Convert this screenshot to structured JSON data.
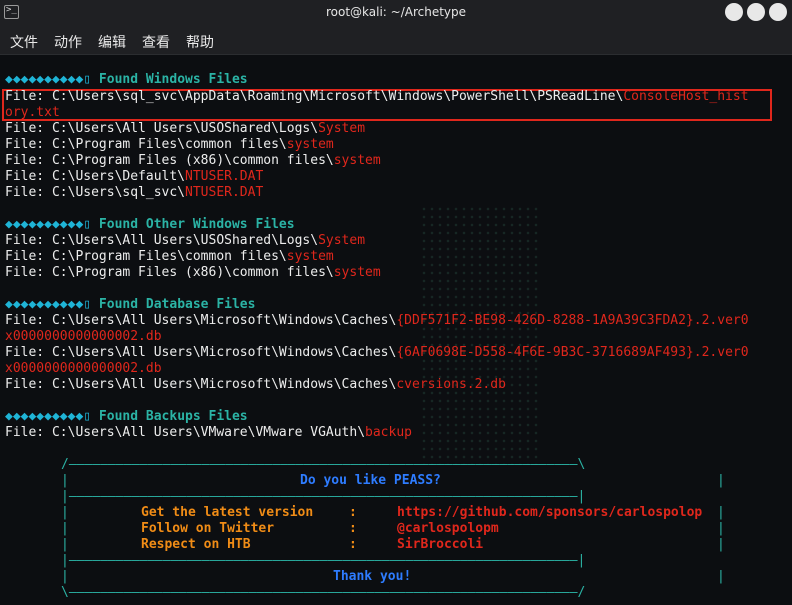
{
  "window": {
    "title": "root@kali: ~/Archetype"
  },
  "menu": [
    "文件",
    "动作",
    "编辑",
    "查看",
    "帮助"
  ],
  "sections": {
    "windows_files": {
      "header": "Found Windows Files",
      "highlight_line": {
        "prefix": "File: C:\\Users\\sql_svc\\AppData\\Roaming\\Microsoft\\Windows\\PowerShell\\PSReadLine\\",
        "name_part1": "ConsoleHost_hist",
        "name_part2": "ory.txt"
      },
      "files": [
        {
          "path": "File: C:\\Users\\All Users\\USOShared\\Logs\\",
          "name": "System"
        },
        {
          "path": "File: C:\\Program Files\\common files\\",
          "name": "system"
        },
        {
          "path": "File: C:\\Program Files (x86)\\common files\\",
          "name": "system"
        },
        {
          "path": "File: C:\\Users\\Default\\",
          "name": "NTUSER.DAT"
        },
        {
          "path": "File: C:\\Users\\sql_svc\\",
          "name": "NTUSER.DAT"
        }
      ]
    },
    "other_windows_files": {
      "header": "Found Other Windows Files",
      "files": [
        {
          "path": "File: C:\\Users\\All Users\\USOShared\\Logs\\",
          "name": "System"
        },
        {
          "path": "File: C:\\Program Files\\common files\\",
          "name": "system"
        },
        {
          "path": "File: C:\\Program Files (x86)\\common files\\",
          "name": "system"
        }
      ]
    },
    "database_files": {
      "header": "Found Database Files",
      "files": [
        {
          "path": "File: C:\\Users\\All Users\\Microsoft\\Windows\\Caches\\",
          "name": "{DDF571F2-BE98-426D-8288-1A9A39C3FDA2}.2.ver0",
          "wrap": "x0000000000000002.db"
        },
        {
          "path": "File: C:\\Users\\All Users\\Microsoft\\Windows\\Caches\\",
          "name": "{6AF0698E-D558-4F6E-9B3C-3716689AF493}.2.ver0",
          "wrap": "x0000000000000002.db"
        },
        {
          "path": "File: C:\\Users\\All Users\\Microsoft\\Windows\\Caches\\",
          "name": "cversions.2.db"
        }
      ]
    },
    "backups_files": {
      "header": "Found Backups Files",
      "files": [
        {
          "path": "File: C:\\Users\\All Users\\VMware\\VMware VGAuth\\",
          "name": "backup"
        }
      ]
    }
  },
  "peass_box": {
    "question": "Do you like PEASS?",
    "rows": [
      {
        "label": "Get the latest version",
        "sep": ":",
        "value": "https://github.com/sponsors/carlospolop"
      },
      {
        "label": "Follow on Twitter",
        "sep": ":",
        "value": "@carlospolopm"
      },
      {
        "label": "Respect on HTB",
        "sep": ":",
        "value": "SirBroccoli"
      }
    ],
    "thanks": "Thank you!"
  }
}
